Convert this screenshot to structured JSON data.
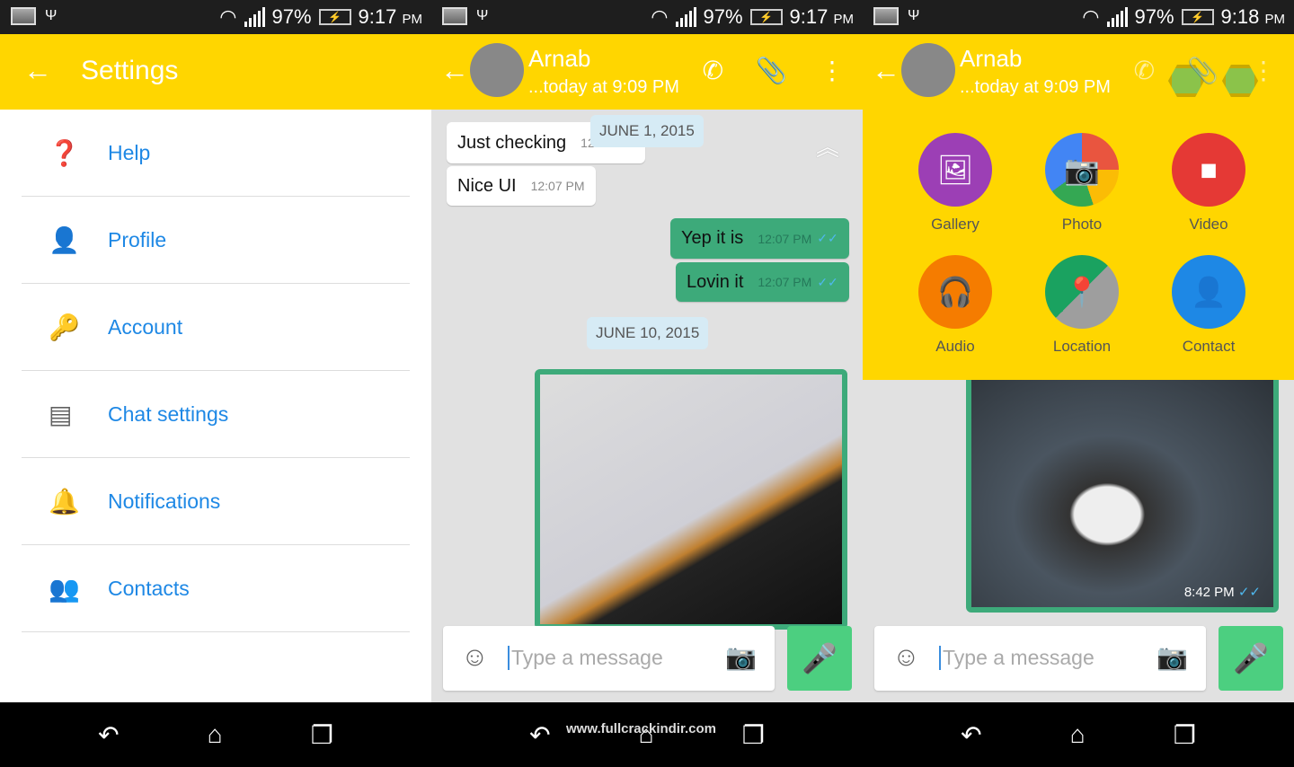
{
  "status": [
    {
      "battery": "97%",
      "time": "9:17",
      "ampm": "PM"
    },
    {
      "battery": "97%",
      "time": "9:17",
      "ampm": "PM"
    },
    {
      "battery": "97%",
      "time": "9:18",
      "ampm": "PM"
    }
  ],
  "settings": {
    "title": "Settings",
    "items": [
      {
        "label": "Help",
        "icon": "help-icon"
      },
      {
        "label": "Profile",
        "icon": "person-icon"
      },
      {
        "label": "Account",
        "icon": "key-icon"
      },
      {
        "label": "Chat settings",
        "icon": "chat-icon"
      },
      {
        "label": "Notifications",
        "icon": "bell-icon"
      },
      {
        "label": "Contacts",
        "icon": "people-icon"
      }
    ]
  },
  "chat": {
    "name": "Arnab",
    "last_seen": "...today at 9:09 PM",
    "messages": [
      {
        "text": "Just checking",
        "time": "12:07 PM"
      },
      {
        "text": "Nice UI",
        "time": "12:07 PM"
      },
      {
        "text": "Yep it is",
        "time": "12:07 PM"
      },
      {
        "text": "Lovin it",
        "time": "12:07 PM"
      }
    ],
    "dates": [
      "JUNE 1, 2015",
      "JUNE 10, 2015"
    ],
    "image_time": "8:42 PM",
    "placeholder": "Type a message"
  },
  "attach": [
    {
      "label": "Gallery",
      "color": "#9c3fb5"
    },
    {
      "label": "Photo",
      "color": "#e9553f"
    },
    {
      "label": "Video",
      "color": "#e53935"
    },
    {
      "label": "Audio",
      "color": "#f57c00"
    },
    {
      "label": "Location",
      "color": "#1aa260"
    },
    {
      "label": "Contact",
      "color": "#1e88e5"
    }
  ],
  "watermark": "www.fullcrackindir.com",
  "colors": {
    "header": "#ffd600",
    "outgoing": "#3daa7a",
    "link": "#1e88e5",
    "mic": "#4ccf80"
  }
}
